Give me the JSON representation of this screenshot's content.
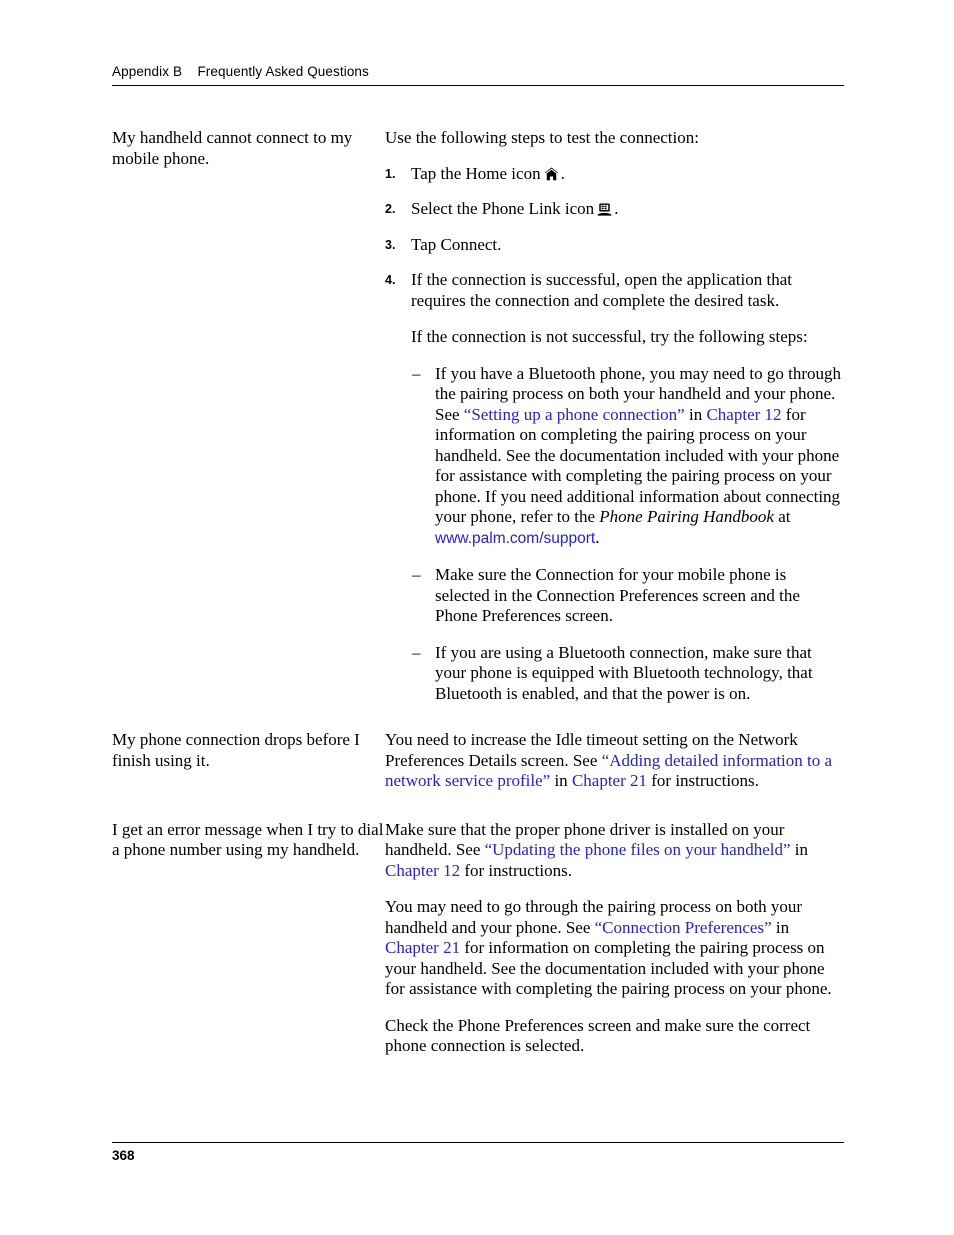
{
  "header": {
    "appendix": "Appendix B",
    "title": "Frequently Asked Questions",
    "full": "Appendix B    Frequently Asked Questions"
  },
  "footer": {
    "page_number": "368"
  },
  "colors": {
    "link_blue": "#2222dd",
    "text_black": "#000000",
    "page_background": "#ffffff"
  },
  "rows": [
    {
      "question": "My handheld cannot connect to my mobile phone.",
      "intro": "Use the following steps to test the connection:",
      "steps": [
        {
          "number": "1.",
          "text_before": "Tap the Home icon",
          "icon": "home-icon",
          "text_after": "."
        },
        {
          "number": "2.",
          "text_before": "Select the Phone Link icon",
          "icon": "phone-link-icon",
          "text_after": "."
        },
        {
          "number": "3.",
          "text_before": "Tap Connect.",
          "icon": "",
          "text_after": ""
        },
        {
          "number": "4.",
          "text_before": "If the connection is successful, open the application that requires the connection and complete the desired task.",
          "icon": "",
          "text_after": ""
        }
      ],
      "step4_followup": "If the connection is not successful, try the following steps:",
      "dash_items": [
        {
          "seg1": "If you have a Bluetooth phone, you may need to go through the pairing process on both your handheld and your phone. See ",
          "link1": "“Setting up a phone connection”",
          "seg2": " in ",
          "link2": "Chapter 12",
          "seg3": " for information on completing the pairing process on your handheld. See the documentation included with your phone for assistance with completing the pairing process on your phone. If you need additional information about connecting your phone, refer to the ",
          "italic": "Phone Pairing Handbook",
          "seg4": " at ",
          "link3": "www.palm.com/support",
          "seg5": "."
        },
        {
          "seg1": "Make sure the Connection for your mobile phone is selected in the Connection Preferences screen and the Phone Preferences screen.",
          "link1": "",
          "seg2": "",
          "link2": "",
          "seg3": "",
          "italic": "",
          "seg4": "",
          "link3": "",
          "seg5": ""
        },
        {
          "seg1": "If you are using a Bluetooth connection, make sure that your phone is equipped with Bluetooth technology, that Bluetooth is enabled, and that the power is on.",
          "link1": "",
          "seg2": "",
          "link2": "",
          "seg3": "",
          "italic": "",
          "seg4": "",
          "link3": "",
          "seg5": ""
        }
      ]
    },
    {
      "question": "My phone connection drops before I finish using it.",
      "answer": {
        "seg1": "You need to increase the Idle timeout setting on the Network Preferences Details screen. See ",
        "link1": "“Adding detailed information to a network service profile”",
        "seg2": " in ",
        "link2": "Chapter 21",
        "seg3": " for instructions."
      }
    },
    {
      "question": "I get an error message when I try to dial a phone number using my handheld.",
      "answer_p1": {
        "seg1": "Make sure that the proper phone driver is installed on your handheld. See ",
        "link1": "“Updating the phone files on your handheld”",
        "seg2": " in ",
        "link2": "Chapter 12",
        "seg3": " for instructions."
      },
      "answer_p2": {
        "seg1": "You may need to go through the pairing process on both your handheld and your phone. See ",
        "link1": "“Connection Preferences”",
        "seg2": " in ",
        "link2": "Chapter 21",
        "seg3": " for information on completing the pairing process on your handheld. See the documentation included with your phone for assistance with completing the pairing process on your phone."
      },
      "answer_p3": "Check the Phone Preferences screen and make sure the correct phone connection is selected."
    }
  ]
}
